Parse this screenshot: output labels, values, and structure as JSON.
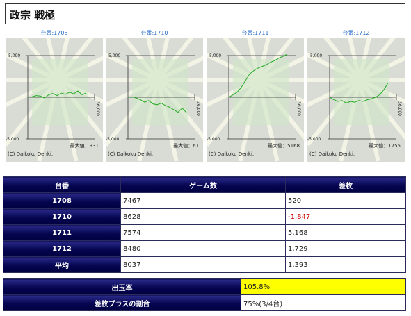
{
  "title": "政宗 戦極",
  "graphs": [
    {
      "label": "台番:1708",
      "max_label": "最大値：931",
      "line_color": "#22aa22",
      "trend": "flat",
      "end_value": 520
    },
    {
      "label": "台番:1710",
      "max_label": "最大値：61",
      "line_color": "#22aa22",
      "trend": "down",
      "end_value": -1847
    },
    {
      "label": "台番:1711",
      "max_label": "最大値：5168",
      "line_color": "#22aa22",
      "trend": "up",
      "end_value": 5168
    },
    {
      "label": "台番:1712",
      "max_label": "最大値：1755",
      "line_color": "#22aa22",
      "trend": "up-late",
      "end_value": 1729
    }
  ],
  "graph_axis": {
    "y_top": "5,000",
    "y_bottom": "-5,000",
    "x_right": "36,000",
    "copyright": "(C) Daikoku Denki."
  },
  "table": {
    "headers": [
      "台番",
      "ゲーム数",
      "差枚"
    ],
    "rows": [
      {
        "id": "1708",
        "games": "7467",
        "diff": "520",
        "negative": false
      },
      {
        "id": "1710",
        "games": "8628",
        "diff": "-1,847",
        "negative": true
      },
      {
        "id": "1711",
        "games": "7574",
        "diff": "5,168",
        "negative": false
      },
      {
        "id": "1712",
        "games": "8480",
        "diff": "1,729",
        "negative": false
      },
      {
        "id": "平均",
        "games": "8037",
        "diff": "1,393",
        "negative": false
      }
    ]
  },
  "summary": {
    "payout_label": "出玉率",
    "payout_value": "105.8%",
    "plus_label": "差枚プラスの割合",
    "plus_value": "75%(3/4台)"
  },
  "colors": {
    "header_bg": "#050550",
    "highlight": "#ffff00",
    "negative": "#cc0000"
  }
}
